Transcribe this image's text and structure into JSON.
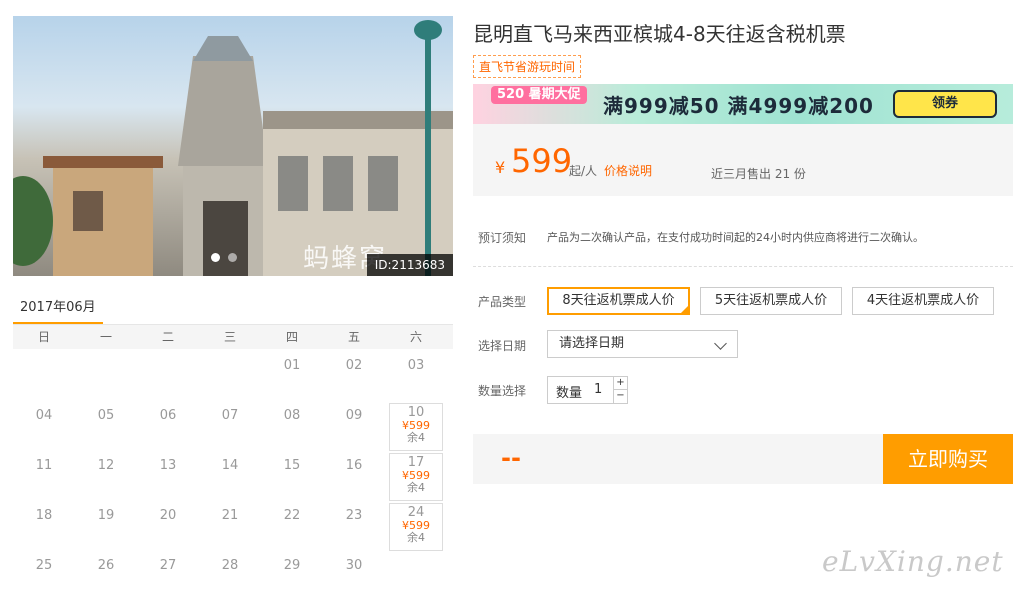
{
  "gallery": {
    "watermark": "蚂蜂窝",
    "id_badge": "ID:2113683",
    "dot_count": 2,
    "active_dot": 0
  },
  "calendar": {
    "month": "2017年06月",
    "weekdays": [
      "日",
      "一",
      "二",
      "三",
      "四",
      "五",
      "六"
    ],
    "rows": [
      [
        {
          "d": ""
        },
        {
          "d": ""
        },
        {
          "d": ""
        },
        {
          "d": ""
        },
        {
          "d": "01"
        },
        {
          "d": "02"
        },
        {
          "d": "03"
        }
      ],
      [
        {
          "d": "04"
        },
        {
          "d": "05"
        },
        {
          "d": "06"
        },
        {
          "d": "07"
        },
        {
          "d": "08"
        },
        {
          "d": "09"
        },
        {
          "d": "10",
          "price": "¥599",
          "stock": "余4"
        }
      ],
      [
        {
          "d": "11"
        },
        {
          "d": "12"
        },
        {
          "d": "13"
        },
        {
          "d": "14"
        },
        {
          "d": "15"
        },
        {
          "d": "16"
        },
        {
          "d": "17",
          "price": "¥599",
          "stock": "余4"
        }
      ],
      [
        {
          "d": "18"
        },
        {
          "d": "19"
        },
        {
          "d": "20"
        },
        {
          "d": "21"
        },
        {
          "d": "22"
        },
        {
          "d": "23"
        },
        {
          "d": "24",
          "price": "¥599",
          "stock": "余4"
        }
      ],
      [
        {
          "d": "25"
        },
        {
          "d": "26"
        },
        {
          "d": "27"
        },
        {
          "d": "28"
        },
        {
          "d": "29"
        },
        {
          "d": "30"
        },
        {
          "d": ""
        }
      ]
    ]
  },
  "product": {
    "title": "昆明直飞马来西亚槟城4-8天往返含税机票",
    "tag": "直飞节省游玩时间"
  },
  "banner": {
    "event": "520 暑期大促",
    "promo": "满999减50  满4999减200",
    "coupon_label": "领券"
  },
  "price": {
    "currency": "¥",
    "amount": "599",
    "unit": "起/人",
    "explain_link": "价格说明",
    "sold": "近三月售出 21 份"
  },
  "booking": {
    "notice_label": "预订须知",
    "notice_text": "产品为二次确认产品，在支付成功时间起的24小时内供应商将进行二次确认。",
    "type_label": "产品类型",
    "types": [
      "8天往返机票成人价",
      "5天往返机票成人价",
      "4天往返机票成人价"
    ],
    "selected_type": 0,
    "date_label": "选择日期",
    "date_placeholder": "请选择日期",
    "qty_label": "数量选择",
    "qty_field_label": "数量",
    "qty_value": "1",
    "qty_plus": "+",
    "qty_minus": "−"
  },
  "purchase": {
    "total": "--",
    "buy_label": "立即购买"
  },
  "site_watermark": "eLvXing.net",
  "colors": {
    "accent": "#ff9d00",
    "price": "#ff6600"
  }
}
